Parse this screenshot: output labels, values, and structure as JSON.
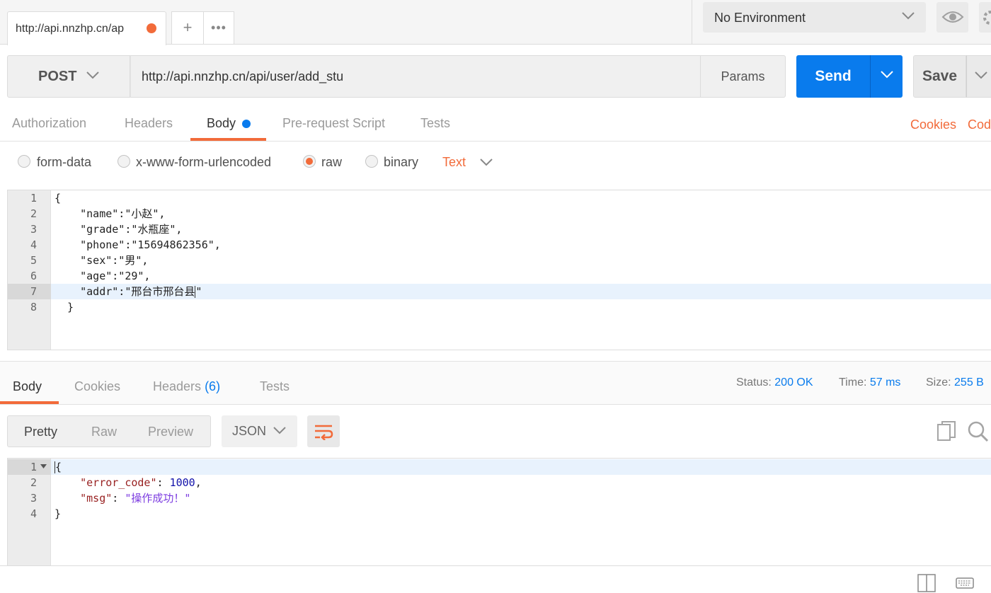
{
  "tabs": {
    "active_tab_label": "http://api.nnzhp.cn/ap",
    "new_tab_label": "+",
    "more_tabs_label": "•••"
  },
  "environment": {
    "selected": "No Environment"
  },
  "request": {
    "method": "POST",
    "url": "http://api.nnzhp.cn/api/user/add_stu",
    "params_label": "Params",
    "send_label": "Send",
    "save_label": "Save"
  },
  "request_tabs": {
    "authorization": "Authorization",
    "headers": "Headers",
    "body": "Body",
    "pre_request": "Pre-request Script",
    "tests": "Tests",
    "cookies_link": "Cookies",
    "code_link": "Code"
  },
  "body_types": {
    "form_data": "form-data",
    "urlencoded": "x-www-form-urlencoded",
    "raw": "raw",
    "binary": "binary",
    "selected": "raw",
    "raw_format": "Text"
  },
  "request_body": {
    "line_numbers": [
      "1",
      "2",
      "3",
      "4",
      "5",
      "6",
      "7",
      "8"
    ],
    "lines": [
      "{",
      "    \"name\":\"小赵\",",
      "    \"grade\":\"水瓶座\",",
      "    \"phone\":\"15694862356\",",
      "    \"sex\":\"男\",",
      "    \"age\":\"29\",",
      "    \"addr\":\"邢台市邢台县",
      "  }"
    ],
    "line7_tail": "\""
  },
  "response_tabs": {
    "body": "Body",
    "cookies": "Cookies",
    "headers": "Headers",
    "headers_count": "(6)",
    "tests": "Tests"
  },
  "response_meta": {
    "status_label": "Status:",
    "status_value": "200 OK",
    "time_label": "Time:",
    "time_value": "57 ms",
    "size_label": "Size:",
    "size_value": "255 B"
  },
  "response_view": {
    "pretty": "Pretty",
    "raw": "Raw",
    "preview": "Preview",
    "format": "JSON"
  },
  "response_body": {
    "line_numbers": [
      "1",
      "2",
      "3",
      "4"
    ],
    "open_brace": "{",
    "key1": "\"error_code\"",
    "val1": "1000",
    "key2": "\"msg\"",
    "val2": "\"操作成功！\"",
    "close_brace": "}"
  },
  "colors": {
    "accent_orange": "#f26b3a",
    "primary_blue": "#097bed"
  }
}
